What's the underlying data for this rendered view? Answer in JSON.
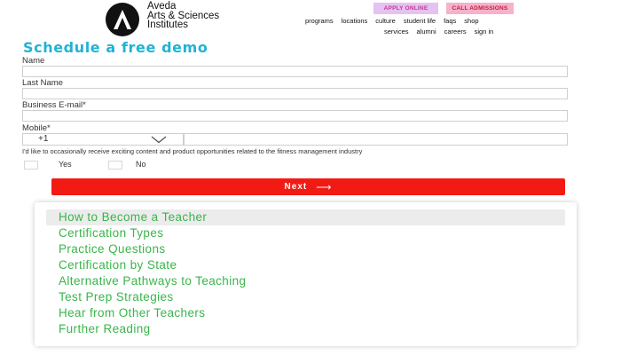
{
  "header": {
    "logo_lines": [
      "Aveda",
      "Arts & Sciences",
      "Institutes"
    ],
    "apply_label": "APPLY ONLINE",
    "call_label": "CALL ADMISSIONS",
    "nav_primary": [
      "programs",
      "locations",
      "culture",
      "student life",
      "faqs",
      "shop"
    ],
    "nav_secondary": [
      "services",
      "alumni",
      "careers",
      "sign in"
    ]
  },
  "form": {
    "title": "Schedule a free demo",
    "name_label": "Name",
    "last_name_label": "Last Name",
    "email_label": "Business E-mail*",
    "mobile_label": "Mobile*",
    "country_code": "+1",
    "consent_text": "I'd like to occasionally receive exciting content and product opportunities related to the fitness management industry",
    "yes_label": "Yes",
    "no_label": "No",
    "submit_label": "Next",
    "submit_arrow": "⟶"
  },
  "toc": {
    "items": [
      "How to Become a Teacher",
      "Certification Types",
      "Practice Questions",
      "Certification by State",
      "Alternative Pathways to Teaching",
      "Test Prep Strategies",
      "Hear from Other Teachers",
      "Further Reading"
    ],
    "active_index": 0
  },
  "colors": {
    "title": "#20b3d3",
    "next_button": "#f21b14",
    "toc_link": "#39b54a",
    "apply_bg": "#e5c2f2",
    "call_bg": "#f6b1cb"
  }
}
